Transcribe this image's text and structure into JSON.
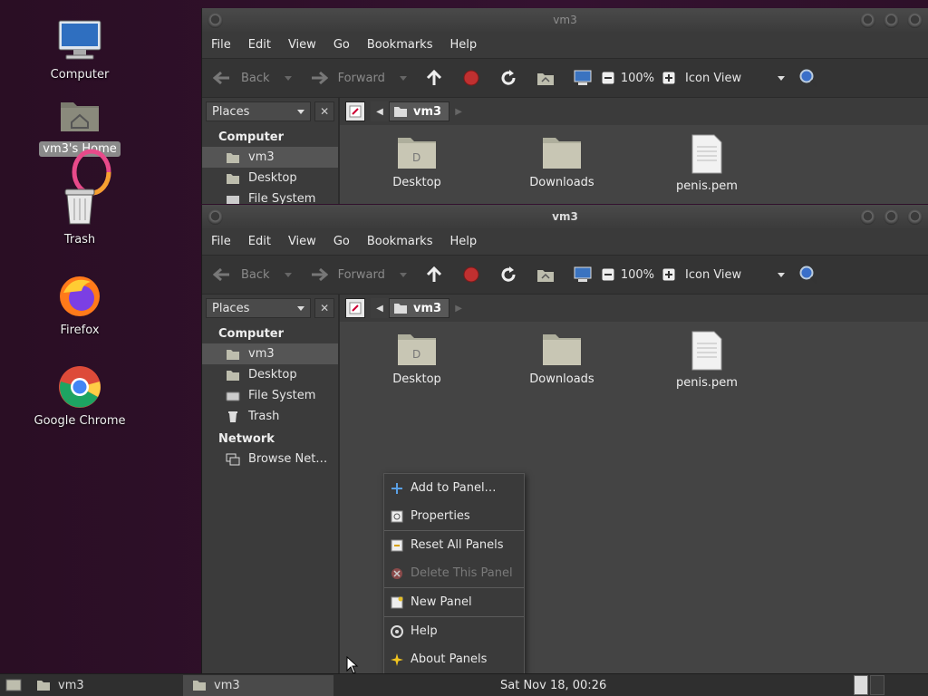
{
  "desktop": {
    "icons": [
      {
        "label": "Computer"
      },
      {
        "label": "vm3's Home"
      },
      {
        "label": "Trash"
      },
      {
        "label": "Firefox"
      },
      {
        "label": "Google Chrome"
      }
    ]
  },
  "window_back": {
    "title": "vm3",
    "menu": [
      "File",
      "Edit",
      "View",
      "Go",
      "Bookmarks",
      "Help"
    ],
    "toolbar": {
      "back": "Back",
      "forward": "Forward",
      "zoom": "100%",
      "view_mode": "Icon View"
    },
    "sidebar": {
      "places_label": "Places",
      "group_computer": "Computer",
      "items": [
        "vm3",
        "Desktop",
        "File System"
      ]
    },
    "pathbar": {
      "crumb": "vm3"
    },
    "files": [
      "Desktop",
      "Downloads",
      "penis.pem"
    ]
  },
  "window_front": {
    "title": "vm3",
    "menu": [
      "File",
      "Edit",
      "View",
      "Go",
      "Bookmarks",
      "Help"
    ],
    "toolbar": {
      "back": "Back",
      "forward": "Forward",
      "zoom": "100%",
      "view_mode": "Icon View"
    },
    "sidebar": {
      "places_label": "Places",
      "group_computer": "Computer",
      "items": [
        "vm3",
        "Desktop",
        "File System",
        "Trash"
      ],
      "group_network": "Network",
      "network_items": [
        "Browse Net…"
      ]
    },
    "pathbar": {
      "crumb": "vm3"
    },
    "files": [
      "Desktop",
      "Downloads",
      "penis.pem"
    ]
  },
  "context_menu": {
    "items": [
      "Add to Panel…",
      "Properties",
      "Reset All Panels",
      "Delete This Panel",
      "New Panel",
      "Help",
      "About Panels"
    ]
  },
  "panel": {
    "tasks": [
      "vm3",
      "vm3"
    ],
    "clock": "Sat Nov 18, 00:26"
  },
  "colors": {
    "accent_red": "#c03030",
    "folder": "#c8c6b4",
    "panel_bg": "#2f2f2f"
  }
}
